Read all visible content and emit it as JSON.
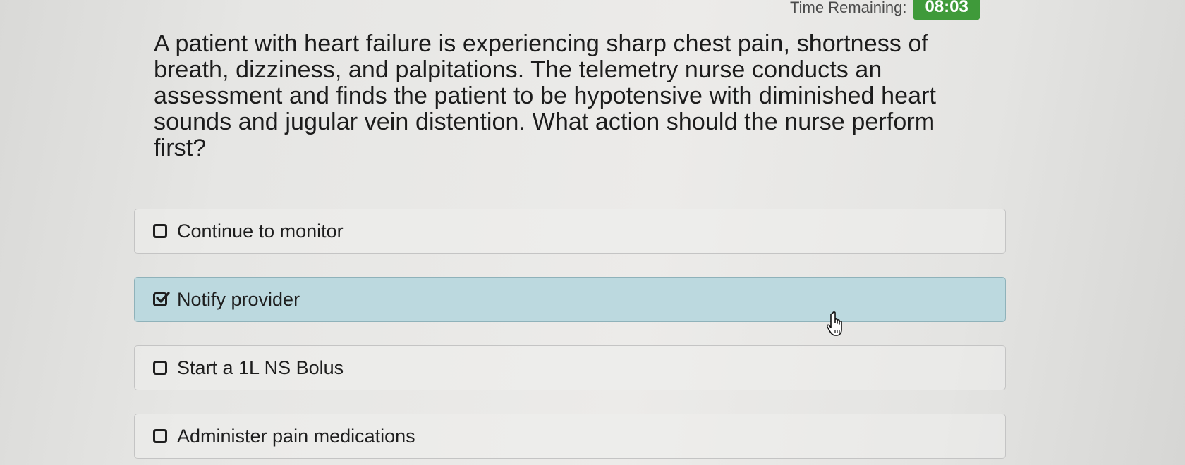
{
  "timer": {
    "label": "Time Remaining:",
    "value": "08:03"
  },
  "question": {
    "text": "A patient with heart failure is experiencing sharp chest pain, shortness of breath, dizziness, and palpitations. The telemetry nurse conducts an assessment and finds the patient to be hypotensive with diminished heart sounds and jugular vein distention. What action should the nurse perform first?"
  },
  "options": [
    {
      "label": "Continue to monitor",
      "selected": false
    },
    {
      "label": "Notify provider",
      "selected": true
    },
    {
      "label": "Start a 1L NS Bolus",
      "selected": false
    },
    {
      "label": "Administer pain medications",
      "selected": false
    }
  ],
  "colors": {
    "timer_bg": "#3f9a3a",
    "selected_bg": "#bcd9df"
  },
  "icons": {
    "checkbox_empty": "checkbox-empty-icon",
    "checkbox_checked": "checkbox-checked-icon",
    "cursor": "hand-pointer-cursor-icon"
  }
}
